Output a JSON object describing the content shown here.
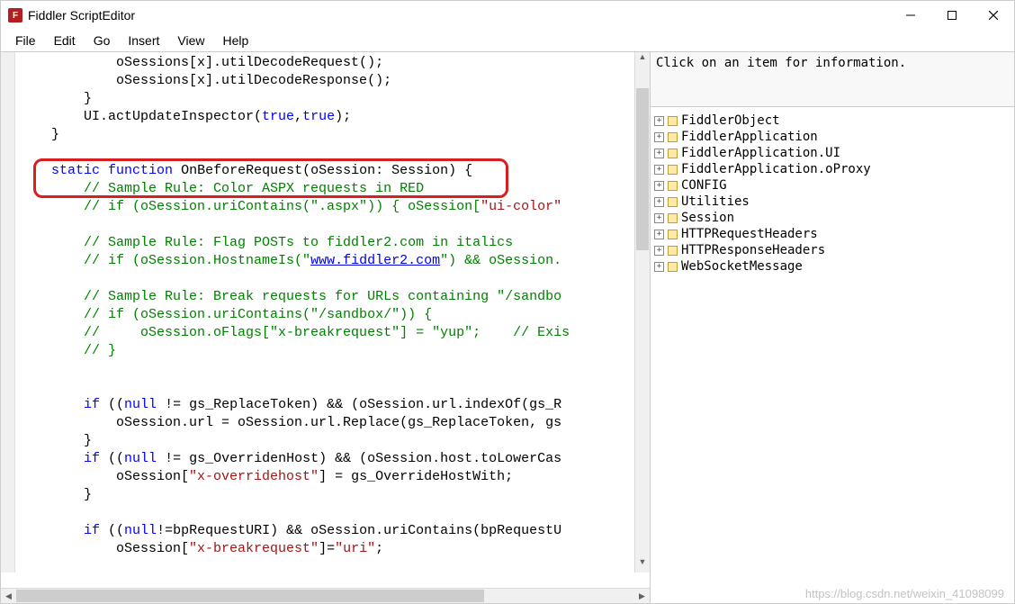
{
  "window": {
    "title": "Fiddler ScriptEditor"
  },
  "menu": {
    "file": "File",
    "edit": "Edit",
    "go": "Go",
    "insert": "Insert",
    "view": "View",
    "help": "Help"
  },
  "code": {
    "line1": "            oSessions[x].utilDecodeRequest();",
    "line2": "            oSessions[x].utilDecodeResponse();",
    "line3": "        }",
    "line4a": "        UI.actUpdateInspector(",
    "line4b": "true",
    "line4c": ",",
    "line4d": "true",
    "line4e": ");",
    "line5": "    }",
    "line6": "",
    "line7a": "    ",
    "line7b": "static",
    "line7c": " ",
    "line7d": "function",
    "line7e": " OnBeforeRequest(oSession: Session) {",
    "line8": "        // Sample Rule: Color ASPX requests in RED",
    "line9a": "        // if (oSession.uriContains(\".aspx\")) { oSession[",
    "line9b": "\"ui-color\"",
    "line10": "",
    "line11": "        // Sample Rule: Flag POSTs to fiddler2.com in italics",
    "line12a": "        // if (oSession.HostnameIs(\"",
    "line12b": "www.fiddler2.com",
    "line12c": "\") && oSession.",
    "line13": "",
    "line14": "        // Sample Rule: Break requests for URLs containing \"/sandbo",
    "line15": "        // if (oSession.uriContains(\"/sandbox/\")) {",
    "line16": "        //     oSession.oFlags[\"x-breakrequest\"] = \"yup\";    // Exis",
    "line17": "        // }",
    "line18": "",
    "line19": "",
    "line20a": "        ",
    "line20b": "if",
    "line20c": " ((",
    "line20d": "null",
    "line20e": " != gs_ReplaceToken) && (oSession.url.indexOf(gs_R",
    "line21": "            oSession.url = oSession.url.Replace(gs_ReplaceToken, gs",
    "line22": "        }",
    "line23a": "        ",
    "line23b": "if",
    "line23c": " ((",
    "line23d": "null",
    "line23e": " != gs_OverridenHost) && (oSession.host.toLowerCas",
    "line24a": "            oSession[",
    "line24b": "\"x-overridehost\"",
    "line24c": "] = gs_OverrideHostWith;",
    "line25": "        }",
    "line26": "",
    "line27a": "        ",
    "line27b": "if",
    "line27c": " ((",
    "line27d": "null",
    "line27e": "!=bpRequestURI) && oSession.uriContains(bpRequestU",
    "line28a": "            oSession[",
    "line28b": "\"x-breakrequest\"",
    "line28c": "]=",
    "line28d": "\"uri\"",
    "line28e": ";"
  },
  "info": {
    "text": "Click on an item for information."
  },
  "tree": {
    "items": [
      "FiddlerObject",
      "FiddlerApplication",
      "FiddlerApplication.UI",
      "FiddlerApplication.oProxy",
      "CONFIG",
      "Utilities",
      "Session",
      "HTTPRequestHeaders",
      "HTTPResponseHeaders",
      "WebSocketMessage"
    ]
  },
  "watermark": "https://blog.csdn.net/weixin_41098099"
}
